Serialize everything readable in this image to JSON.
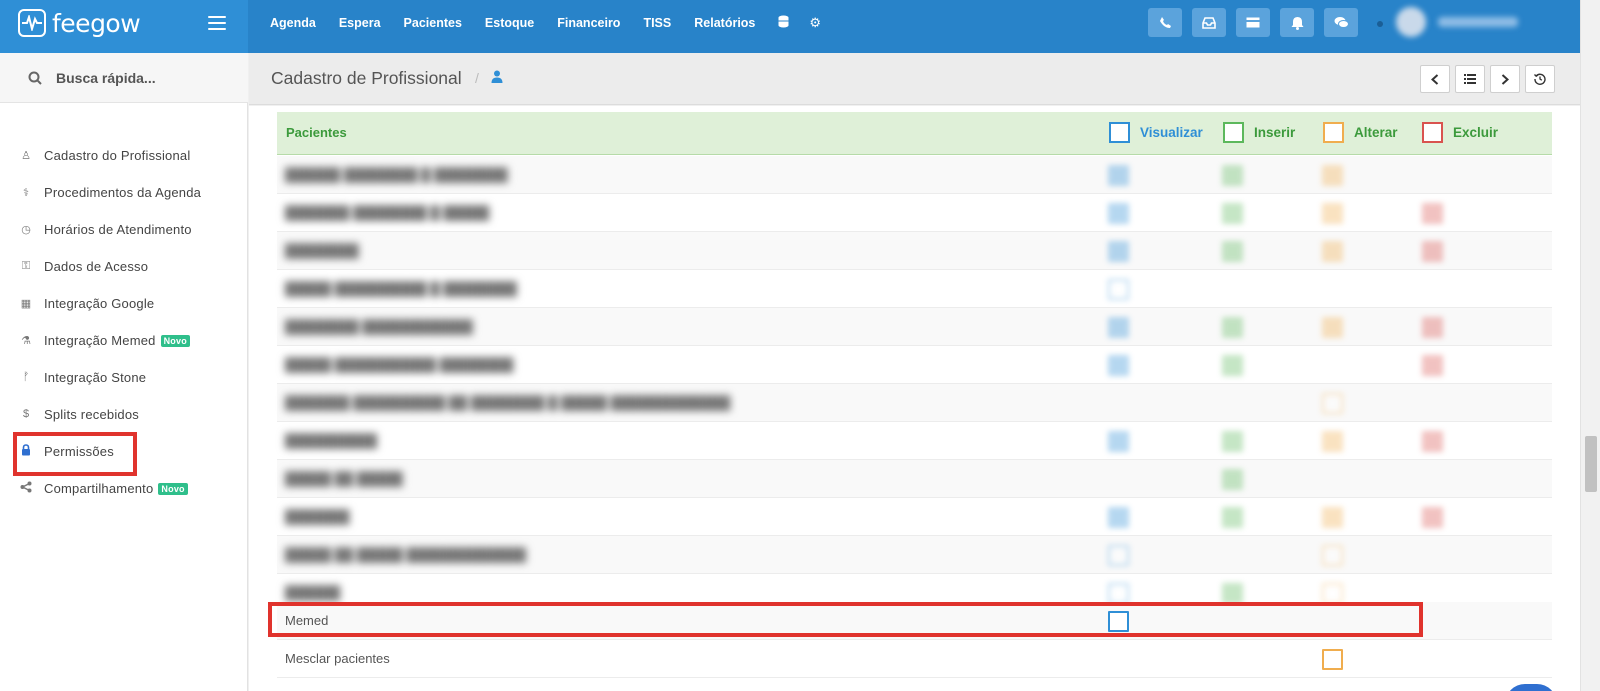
{
  "brand": {
    "name": "feegow"
  },
  "topnav": {
    "items": [
      "Agenda",
      "Espera",
      "Pacientes",
      "Estoque",
      "Financeiro",
      "TISS",
      "Relatórios"
    ],
    "icon_items": [
      "database-icon",
      "gear-icon"
    ]
  },
  "top_actions": [
    "phone-icon",
    "inbox-icon",
    "card-icon",
    "bell-icon",
    "chat-icon"
  ],
  "search": {
    "placeholder": "Busca rápida..."
  },
  "sidebar": {
    "items": [
      {
        "label": "Cadastro do Profissional",
        "icon": "user-md-icon",
        "glyph": "♙",
        "badge": ""
      },
      {
        "label": "Procedimentos da Agenda",
        "icon": "stethoscope-icon",
        "glyph": "⚕",
        "badge": ""
      },
      {
        "label": "Horários de Atendimento",
        "icon": "clock-icon",
        "glyph": "◷",
        "badge": ""
      },
      {
        "label": "Dados de Acesso",
        "icon": "key-icon",
        "glyph": "⚿",
        "badge": ""
      },
      {
        "label": "Integração Google",
        "icon": "calendar-icon",
        "glyph": "▦",
        "badge": ""
      },
      {
        "label": "Integração Memed",
        "icon": "flask-icon",
        "glyph": "⚗",
        "badge": "Novo"
      },
      {
        "label": "Integração Stone",
        "icon": "branch-icon",
        "glyph": "ᚠ",
        "badge": ""
      },
      {
        "label": "Splits recebidos",
        "icon": "dollar-icon",
        "glyph": "$",
        "badge": ""
      },
      {
        "label": "Permissões",
        "icon": "lock-icon",
        "glyph": "🔒",
        "badge": ""
      },
      {
        "label": "Compartilhamento",
        "icon": "share-icon",
        "glyph": "⋖",
        "badge": "Novo"
      }
    ]
  },
  "header": {
    "title": "Cadastro de Profissional",
    "separator": "/"
  },
  "table": {
    "section": "Pacientes",
    "columns": [
      {
        "label": "Visualizar",
        "color": "#2f8fd6"
      },
      {
        "label": "Inserir",
        "color": "#5cb85c"
      },
      {
        "label": "Alterar",
        "color": "#f0ad4e"
      },
      {
        "label": "Excluir",
        "color": "#d9534f"
      }
    ],
    "visible_rows": [
      {
        "label": "Memed"
      },
      {
        "label": "Mesclar pacientes"
      }
    ]
  },
  "colors": {
    "topbar": "#2883c9",
    "logo_bg": "#2f8fd6",
    "highlight": "#e0332d",
    "header_green": "#dff0d8",
    "novo_badge": "#2fbf8b"
  }
}
